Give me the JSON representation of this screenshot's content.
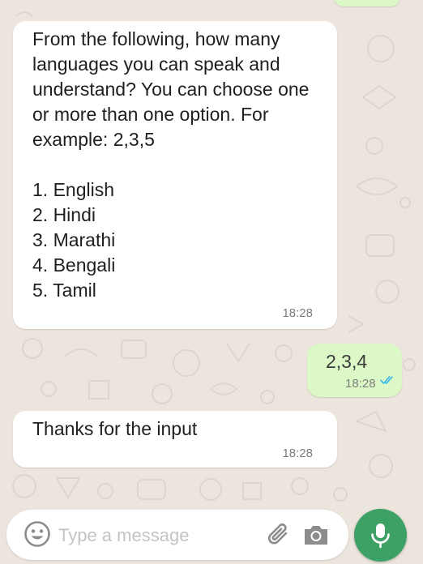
{
  "messages": [
    {
      "id": "question",
      "direction": "incoming",
      "text": "From the following, how many languages you can speak and understand? You can choose one or more than one option. For example: 2,3,5\n\n1. English\n2. Hindi\n3. Marathi\n4. Bengali\n5. Tamil",
      "time": "18:28"
    },
    {
      "id": "reply",
      "direction": "outgoing",
      "text": "2,3,4",
      "time": "18:28",
      "status": "read"
    },
    {
      "id": "thanks",
      "direction": "incoming",
      "text": "Thanks for the input",
      "time": "18:28"
    }
  ],
  "composer": {
    "placeholder": "Type a message",
    "icons": [
      "emoji-icon",
      "paperclip-icon",
      "camera-icon",
      "microphone-icon"
    ]
  },
  "colors": {
    "chat_background": "#ece5dd",
    "incoming_bubble": "#ffffff",
    "outgoing_bubble": "#dcf8c6",
    "send_button": "#3da166",
    "read_ticks": "#34b7f1"
  }
}
